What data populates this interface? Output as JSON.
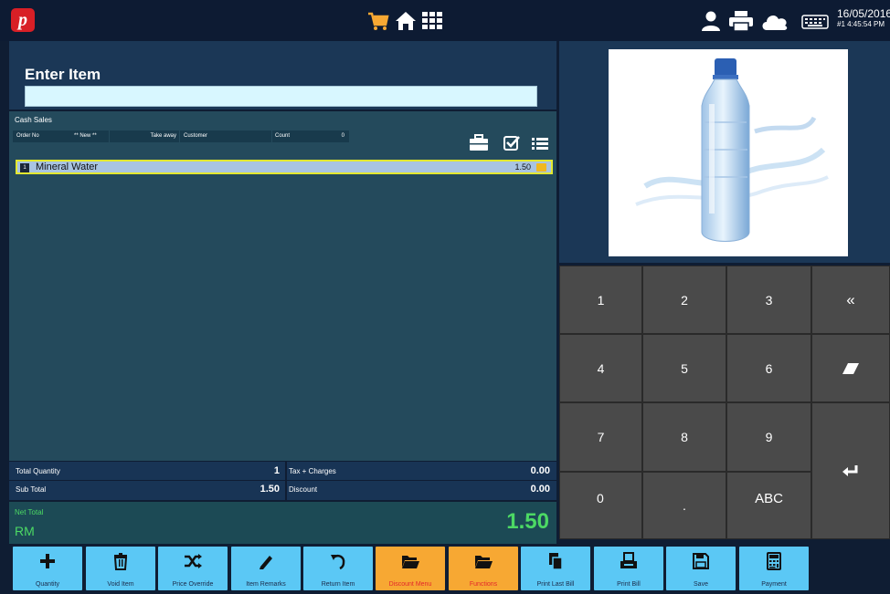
{
  "header": {
    "logo_letter": "p",
    "date": "16/05/2016",
    "time": "#1 4:45:54 PM",
    "icons": [
      "cart-icon",
      "home-icon",
      "grid-menu-icon",
      "user-icon",
      "printer-icon",
      "cloud-icon",
      "keyboard-icon"
    ],
    "colors": {
      "accent": "#f7a833",
      "logo": "#d81f26"
    }
  },
  "entry": {
    "title": "Enter Item",
    "value": ""
  },
  "order": {
    "section": "Cash Sales",
    "order_no_label": "Order No",
    "order_no_value": "** New **",
    "takeaway_label": "Take away",
    "customer_label": "Customer",
    "count_label": "Count",
    "count_value": "0",
    "items": [
      {
        "qty": "1",
        "name": "Mineral Water",
        "price": "1.50"
      }
    ]
  },
  "totals": {
    "total_quantity_label": "Total Quantity",
    "total_quantity": "1",
    "sub_total_label": "Sub Total",
    "sub_total": "1.50",
    "tax_label": "Tax + Charges",
    "tax": "0.00",
    "discount_label": "Discount",
    "discount": "0.00",
    "net_total_label": "Net Total",
    "currency": "RM",
    "net_total": "1.50"
  },
  "keypad": {
    "keys": [
      "1",
      "2",
      "3",
      "«",
      "4",
      "5",
      "6",
      "7",
      "8",
      "9",
      "0",
      ".",
      "ABC"
    ]
  },
  "bottom": {
    "buttons": [
      {
        "label": "Quantity",
        "icon": "plus-icon"
      },
      {
        "label": "Void Item",
        "icon": "trash-icon"
      },
      {
        "label": "Price Override",
        "icon": "shuffle-icon"
      },
      {
        "label": "Item Remarks",
        "icon": "pencil-icon"
      },
      {
        "label": "Return Item",
        "icon": "undo-icon"
      },
      {
        "label": "Discount Menu",
        "icon": "folder-icon"
      },
      {
        "label": "Functions",
        "icon": "folder-icon"
      },
      {
        "label": "Print Last Bill",
        "icon": "copy-icon"
      },
      {
        "label": "Print Bill",
        "icon": "printer-icon"
      },
      {
        "label": "Save",
        "icon": "floppy-icon"
      },
      {
        "label": "Payment",
        "icon": "calculator-icon"
      }
    ]
  }
}
